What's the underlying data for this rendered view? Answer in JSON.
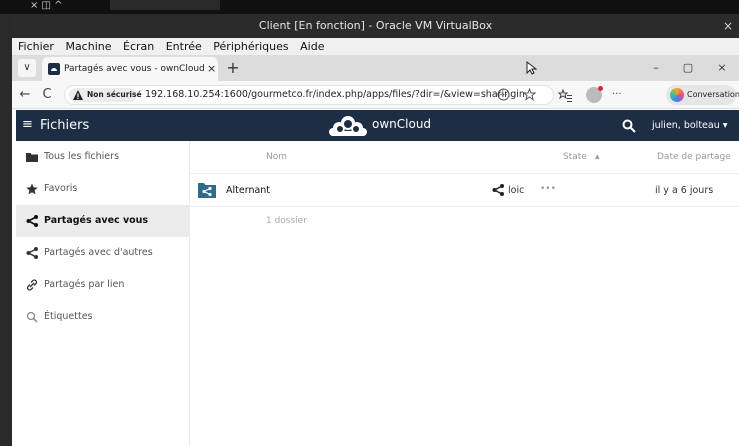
{
  "host": {
    "strip_glyphs": "×  ◫  ^"
  },
  "vbox": {
    "title": "Client [En fonction] - Oracle VM VirtualBox",
    "close": "×",
    "menu": [
      "Fichier",
      "Machine",
      "Écran",
      "Entrée",
      "Périphériques",
      "Aide"
    ]
  },
  "browser": {
    "tab_dropdown": "∨",
    "tab_title": "Partagés avec vous - ownCloud",
    "tab_close": "×",
    "new_tab": "+",
    "window_controls": [
      "–",
      "▢",
      "×"
    ],
    "nav": {
      "back": "←",
      "reload": "C"
    },
    "security_label": "Non sécurisé",
    "url": "192.168.10.254:1600/gourmetco.fr/index.php/apps/files/?dir=/&view=sharingin",
    "more": "···",
    "copilot_label": "Conversation"
  },
  "owncloud": {
    "app_name": "Fichiers",
    "brand": "ownCloud",
    "user": "julien, bolteau ▾",
    "sidebar": [
      {
        "label": "Tous les fichiers",
        "icon": "folder-icon",
        "active": false
      },
      {
        "label": "Favoris",
        "icon": "star-icon",
        "active": false
      },
      {
        "label": "Partagés avec vous",
        "icon": "share-icon",
        "active": true
      },
      {
        "label": "Partagés avec d'autres",
        "icon": "share-icon",
        "active": false
      },
      {
        "label": "Partagés par lien",
        "icon": "link-icon",
        "active": false
      },
      {
        "label": "Étiquettes",
        "icon": "tag-search-icon",
        "active": false
      }
    ],
    "columns": {
      "name": "Nom",
      "state": "State",
      "date": "Date de partage"
    },
    "rows": [
      {
        "name": "Alternant",
        "shared_by": "loic",
        "more": "•••",
        "date": "il y a 6 jours"
      }
    ],
    "summary": "1 dossier"
  },
  "colors": {
    "header": "#1d2d44",
    "active_item": "#ebebeb",
    "folder_share": "#2e6b8e"
  }
}
